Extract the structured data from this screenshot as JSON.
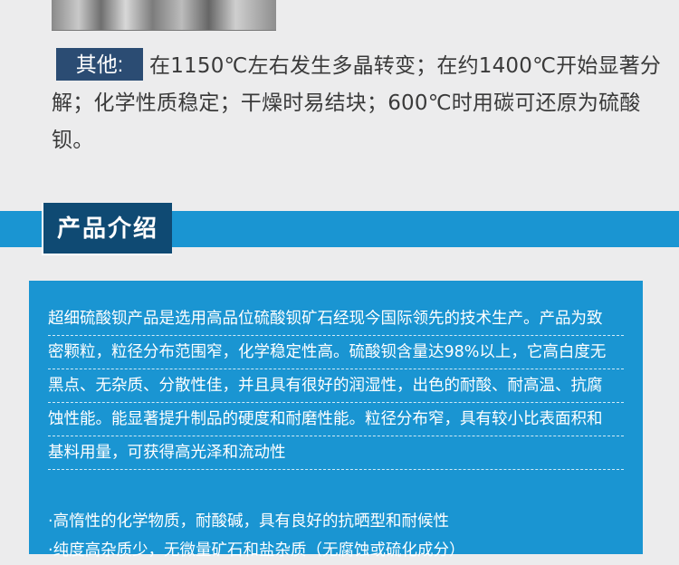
{
  "other": {
    "tag": "其他:",
    "text": "在1150℃左右发生多晶转变；在约1400℃开始显著分解；化学性质稳定；干燥时易结块；600℃时用碳可还原为硫酸钡。"
  },
  "section": {
    "title": "产品介绍"
  },
  "intro": {
    "lines": [
      "超细硫酸钡产品是选用高品位硫酸钡矿石经现今国际领先的技术生产。产品为致",
      "密颗粒，粒径分布范围窄，化学稳定性高。硫酸钡含量达98%以上，它高白度无",
      "黑点、无杂质、分散性佳，并且具有很好的润湿性，出色的耐酸、耐高温、抗腐",
      "蚀性能。能显著提升制品的硬度和耐磨性能。粒径分布窄，具有较小比表面积和",
      "基料用量，可获得高光泽和流动性"
    ]
  },
  "features": [
    "·高惰性的化学物质，耐酸碱，具有良好的抗晒型和耐候性",
    "·纯度高杂质少，无微量矿石和盐杂质（无腐蚀或硫化成分）"
  ],
  "colors": {
    "band": "#1a95d2",
    "tab": "#0f4a73",
    "other_tag": "#2b4c73",
    "text": "#3a3a3a",
    "background": "#ececed"
  }
}
